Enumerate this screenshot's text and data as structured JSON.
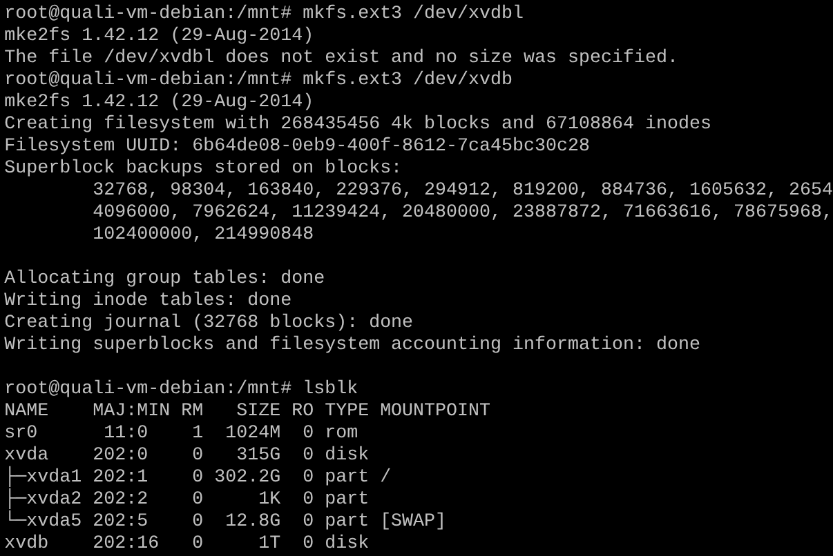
{
  "terminal": {
    "blocks": [
      [
        "root@quali-vm-debian:/mnt# mkfs.ext3 /dev/xvdbl",
        "mke2fs 1.42.12 (29-Aug-2014)",
        "The file /dev/xvdbl does not exist and no size was specified.",
        "root@quali-vm-debian:/mnt# mkfs.ext3 /dev/xvdb",
        "mke2fs 1.42.12 (29-Aug-2014)",
        "Creating filesystem with 268435456 4k blocks and 67108864 inodes",
        "Filesystem UUID: 6b64de08-0eb9-400f-8612-7ca45bc30c28",
        "Superblock backups stored on blocks:",
        "        32768, 98304, 163840, 229376, 294912, 819200, 884736, 1605632, 2654",
        "        4096000, 7962624, 11239424, 20480000, 23887872, 71663616, 78675968,",
        "        102400000, 214990848"
      ],
      [
        "Allocating group tables: done",
        "Writing inode tables: done",
        "Creating journal (32768 blocks): done",
        "Writing superblocks and filesystem accounting information: done"
      ],
      [
        "root@quali-vm-debian:/mnt# lsblk",
        "NAME    MAJ:MIN RM   SIZE RO TYPE MOUNTPOINT",
        "sr0      11:0    1  1024M  0 rom",
        "xvda    202:0    0   315G  0 disk",
        "├─xvda1 202:1    0 302.2G  0 part /",
        "├─xvda2 202:2    0     1K  0 part",
        "└─xvda5 202:5    0  12.8G  0 part [SWAP]",
        "xvdb    202:16   0     1T  0 disk"
      ]
    ]
  }
}
